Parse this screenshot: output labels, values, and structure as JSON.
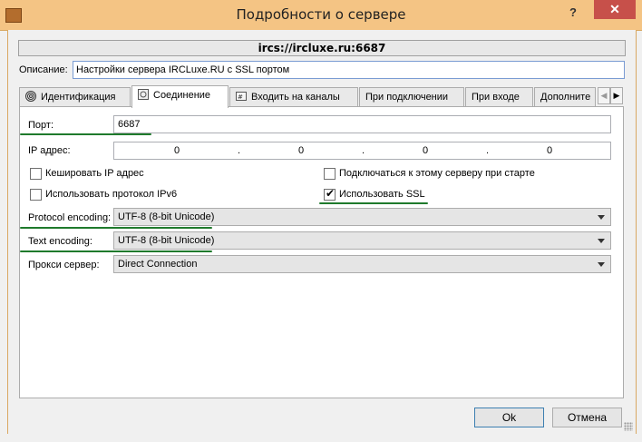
{
  "window": {
    "title": "Подробности о сервере",
    "help_label": "?",
    "close_label": "✕"
  },
  "server_url": "ircs://ircluxe.ru:6687",
  "description": {
    "label": "Описание:",
    "value": "Настройки сервера IRCLuxe.RU с SSL портом"
  },
  "tabs": [
    {
      "label": "Идентификация",
      "icon": "fingerprint-icon"
    },
    {
      "label": "Соединение",
      "icon": "connection-icon"
    },
    {
      "label": "Входить на каналы",
      "icon": "channels-icon"
    },
    {
      "label": "При подключении"
    },
    {
      "label": "При входе"
    },
    {
      "label": "Дополните"
    }
  ],
  "connection": {
    "port_label": "Порт:",
    "port_value": "6687",
    "ip_label": "IP адрес:",
    "ip_octets": [
      "0",
      "0",
      "0",
      "0"
    ],
    "ip_separator": ".",
    "cache_ip_label": "Кешировать IP адрес",
    "cache_ip_checked": false,
    "ipv6_label": "Использовать протокол IPv6",
    "ipv6_checked": false,
    "autoconnect_label": "Подключаться к этому серверу при старте",
    "autoconnect_checked": false,
    "ssl_label": "Использовать SSL",
    "ssl_checked": true,
    "protocol_encoding_label": "Protocol encoding:",
    "protocol_encoding_value": "UTF-8 (8-bit Unicode)",
    "text_encoding_label": "Text encoding:",
    "text_encoding_value": "UTF-8 (8-bit Unicode)",
    "proxy_label": "Прокси сервер:",
    "proxy_value": "Direct Connection"
  },
  "buttons": {
    "ok": "Ok",
    "cancel": "Отмена"
  },
  "colors": {
    "titlebar": "#f4c484",
    "close": "#c7504a",
    "annotation": "#1f7a2c"
  }
}
